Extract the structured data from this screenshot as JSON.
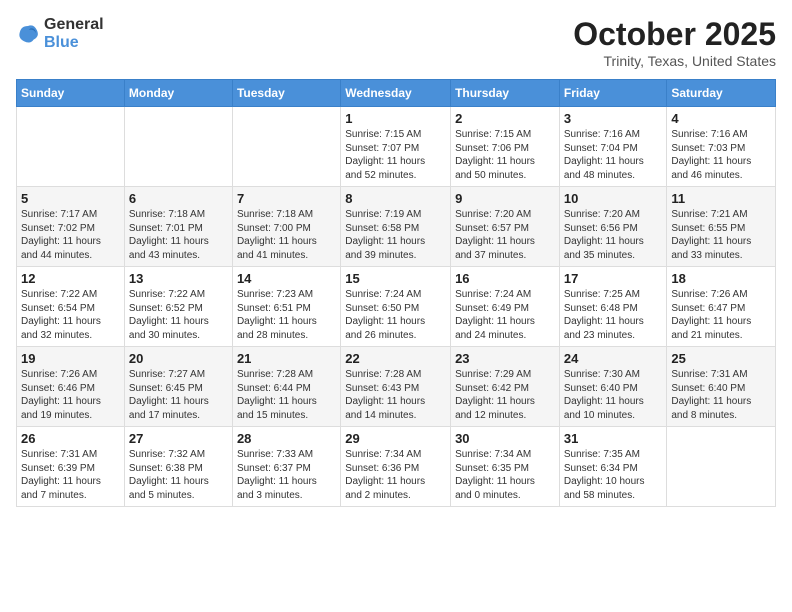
{
  "header": {
    "logo_general": "General",
    "logo_blue": "Blue",
    "month": "October 2025",
    "location": "Trinity, Texas, United States"
  },
  "weekdays": [
    "Sunday",
    "Monday",
    "Tuesday",
    "Wednesday",
    "Thursday",
    "Friday",
    "Saturday"
  ],
  "weeks": [
    [
      {
        "day": "",
        "content": ""
      },
      {
        "day": "",
        "content": ""
      },
      {
        "day": "",
        "content": ""
      },
      {
        "day": "1",
        "content": "Sunrise: 7:15 AM\nSunset: 7:07 PM\nDaylight: 11 hours\nand 52 minutes."
      },
      {
        "day": "2",
        "content": "Sunrise: 7:15 AM\nSunset: 7:06 PM\nDaylight: 11 hours\nand 50 minutes."
      },
      {
        "day": "3",
        "content": "Sunrise: 7:16 AM\nSunset: 7:04 PM\nDaylight: 11 hours\nand 48 minutes."
      },
      {
        "day": "4",
        "content": "Sunrise: 7:16 AM\nSunset: 7:03 PM\nDaylight: 11 hours\nand 46 minutes."
      }
    ],
    [
      {
        "day": "5",
        "content": "Sunrise: 7:17 AM\nSunset: 7:02 PM\nDaylight: 11 hours\nand 44 minutes."
      },
      {
        "day": "6",
        "content": "Sunrise: 7:18 AM\nSunset: 7:01 PM\nDaylight: 11 hours\nand 43 minutes."
      },
      {
        "day": "7",
        "content": "Sunrise: 7:18 AM\nSunset: 7:00 PM\nDaylight: 11 hours\nand 41 minutes."
      },
      {
        "day": "8",
        "content": "Sunrise: 7:19 AM\nSunset: 6:58 PM\nDaylight: 11 hours\nand 39 minutes."
      },
      {
        "day": "9",
        "content": "Sunrise: 7:20 AM\nSunset: 6:57 PM\nDaylight: 11 hours\nand 37 minutes."
      },
      {
        "day": "10",
        "content": "Sunrise: 7:20 AM\nSunset: 6:56 PM\nDaylight: 11 hours\nand 35 minutes."
      },
      {
        "day": "11",
        "content": "Sunrise: 7:21 AM\nSunset: 6:55 PM\nDaylight: 11 hours\nand 33 minutes."
      }
    ],
    [
      {
        "day": "12",
        "content": "Sunrise: 7:22 AM\nSunset: 6:54 PM\nDaylight: 11 hours\nand 32 minutes."
      },
      {
        "day": "13",
        "content": "Sunrise: 7:22 AM\nSunset: 6:52 PM\nDaylight: 11 hours\nand 30 minutes."
      },
      {
        "day": "14",
        "content": "Sunrise: 7:23 AM\nSunset: 6:51 PM\nDaylight: 11 hours\nand 28 minutes."
      },
      {
        "day": "15",
        "content": "Sunrise: 7:24 AM\nSunset: 6:50 PM\nDaylight: 11 hours\nand 26 minutes."
      },
      {
        "day": "16",
        "content": "Sunrise: 7:24 AM\nSunset: 6:49 PM\nDaylight: 11 hours\nand 24 minutes."
      },
      {
        "day": "17",
        "content": "Sunrise: 7:25 AM\nSunset: 6:48 PM\nDaylight: 11 hours\nand 23 minutes."
      },
      {
        "day": "18",
        "content": "Sunrise: 7:26 AM\nSunset: 6:47 PM\nDaylight: 11 hours\nand 21 minutes."
      }
    ],
    [
      {
        "day": "19",
        "content": "Sunrise: 7:26 AM\nSunset: 6:46 PM\nDaylight: 11 hours\nand 19 minutes."
      },
      {
        "day": "20",
        "content": "Sunrise: 7:27 AM\nSunset: 6:45 PM\nDaylight: 11 hours\nand 17 minutes."
      },
      {
        "day": "21",
        "content": "Sunrise: 7:28 AM\nSunset: 6:44 PM\nDaylight: 11 hours\nand 15 minutes."
      },
      {
        "day": "22",
        "content": "Sunrise: 7:28 AM\nSunset: 6:43 PM\nDaylight: 11 hours\nand 14 minutes."
      },
      {
        "day": "23",
        "content": "Sunrise: 7:29 AM\nSunset: 6:42 PM\nDaylight: 11 hours\nand 12 minutes."
      },
      {
        "day": "24",
        "content": "Sunrise: 7:30 AM\nSunset: 6:40 PM\nDaylight: 11 hours\nand 10 minutes."
      },
      {
        "day": "25",
        "content": "Sunrise: 7:31 AM\nSunset: 6:40 PM\nDaylight: 11 hours\nand 8 minutes."
      }
    ],
    [
      {
        "day": "26",
        "content": "Sunrise: 7:31 AM\nSunset: 6:39 PM\nDaylight: 11 hours\nand 7 minutes."
      },
      {
        "day": "27",
        "content": "Sunrise: 7:32 AM\nSunset: 6:38 PM\nDaylight: 11 hours\nand 5 minutes."
      },
      {
        "day": "28",
        "content": "Sunrise: 7:33 AM\nSunset: 6:37 PM\nDaylight: 11 hours\nand 3 minutes."
      },
      {
        "day": "29",
        "content": "Sunrise: 7:34 AM\nSunset: 6:36 PM\nDaylight: 11 hours\nand 2 minutes."
      },
      {
        "day": "30",
        "content": "Sunrise: 7:34 AM\nSunset: 6:35 PM\nDaylight: 11 hours\nand 0 minutes."
      },
      {
        "day": "31",
        "content": "Sunrise: 7:35 AM\nSunset: 6:34 PM\nDaylight: 10 hours\nand 58 minutes."
      },
      {
        "day": "",
        "content": ""
      }
    ]
  ]
}
